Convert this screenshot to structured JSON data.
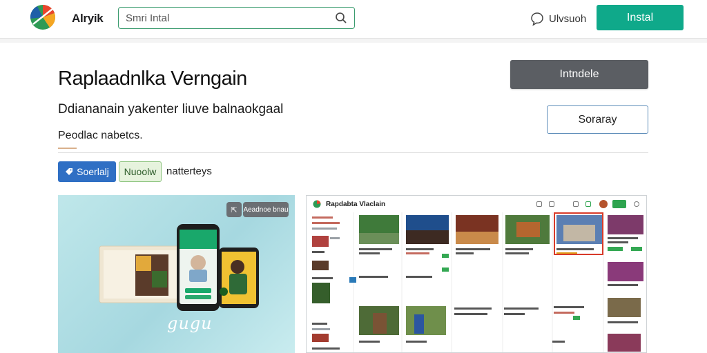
{
  "topbar": {
    "brand": "Alryik",
    "search_placeholder": "Smri Intal",
    "messages_label": "Ulvsuoh",
    "install_label": "Instal"
  },
  "listing": {
    "title": "Raplaadnlka Verngain",
    "subtitle": "Ddiananain yakenter liuve balnaokgaal",
    "meta": "Peodlac nabetcs.",
    "primary_button": "Intndele",
    "secondary_button": "Soraray",
    "tags": {
      "blue": "Soerlalj",
      "green": "Nuoolw",
      "text": "natterteys"
    }
  },
  "hero": {
    "chip_label": "Aeadnoe bnau",
    "script_text": "gugu"
  },
  "preview": {
    "title": "Rapdabta Vlaclain"
  },
  "colors": {
    "accent_green": "#0fa98a",
    "primary_button": "#5b5e63",
    "tag_blue": "#2f6fc4",
    "selected_outline": "#d83a2a"
  },
  "icons": {
    "search": "search-icon",
    "messages": "chat-bubble-icon",
    "tag": "tag-icon",
    "logo": "app-logo"
  }
}
